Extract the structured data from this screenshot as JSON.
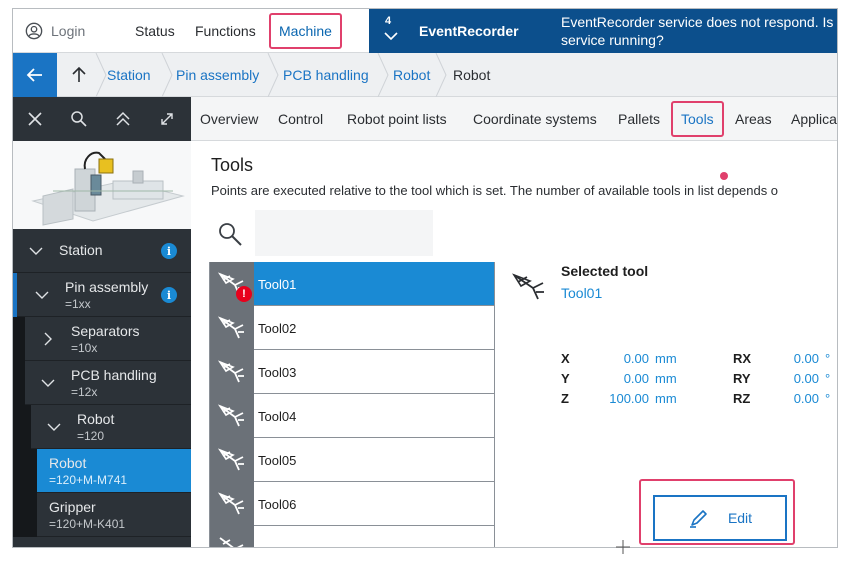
{
  "header": {
    "login_label": "Login",
    "nav": [
      {
        "label": "Status"
      },
      {
        "label": "Functions"
      },
      {
        "label": "Machine"
      }
    ],
    "event": {
      "count": "4",
      "title": "EventRecorder",
      "message_line1": "EventRecorder service does not respond. Is t",
      "message_line2": "service running?"
    }
  },
  "breadcrumb": {
    "items": [
      {
        "label": "Station"
      },
      {
        "label": "Pin assembly"
      },
      {
        "label": "PCB handling"
      },
      {
        "label": "Robot"
      },
      {
        "label": "Robot"
      }
    ]
  },
  "tabs": [
    {
      "label": "Overview"
    },
    {
      "label": "Control"
    },
    {
      "label": "Robot point lists"
    },
    {
      "label": "Coordinate systems"
    },
    {
      "label": "Pallets"
    },
    {
      "label": "Tools"
    },
    {
      "label": "Areas"
    },
    {
      "label": "Applica"
    }
  ],
  "tree": [
    {
      "label": "Station",
      "sub": "",
      "info": "i"
    },
    {
      "label": "Pin assembly",
      "sub": "=1xx",
      "info": "i"
    },
    {
      "label": "Separators",
      "sub": "=10x"
    },
    {
      "label": "PCB handling",
      "sub": "=12x"
    },
    {
      "label": "Robot",
      "sub": "=120"
    },
    {
      "label": "Robot",
      "sub": "=120+M-M741"
    },
    {
      "label": "Gripper",
      "sub": "=120+M-K401"
    }
  ],
  "main": {
    "title": "Tools",
    "description": "Points are executed relative to the tool which is set. The number of available tools in list depends o",
    "search_placeholder": "",
    "tools": [
      {
        "name": "Tool01",
        "error": "!"
      },
      {
        "name": "Tool02"
      },
      {
        "name": "Tool03"
      },
      {
        "name": "Tool04"
      },
      {
        "name": "Tool05"
      },
      {
        "name": "Tool06"
      }
    ],
    "selected": {
      "label": "Selected tool",
      "value": "Tool01"
    },
    "coords": {
      "x": {
        "label": "X",
        "value": "0.00",
        "unit": "mm"
      },
      "y": {
        "label": "Y",
        "value": "0.00",
        "unit": "mm"
      },
      "z": {
        "label": "Z",
        "value": "100.00",
        "unit": "mm"
      },
      "rx": {
        "label": "RX",
        "value": "0.00",
        "unit": "°"
      },
      "ry": {
        "label": "RY",
        "value": "0.00",
        "unit": "°"
      },
      "rz": {
        "label": "RZ",
        "value": "0.00",
        "unit": "°"
      }
    },
    "edit_label": "Edit"
  },
  "colors": {
    "accent_blue": "#1a8ad4",
    "dark_blue": "#0c4f8c",
    "sidebar_dark": "#2c3238",
    "highlight_pink": "#e0406c",
    "error_red": "#e8001c"
  }
}
